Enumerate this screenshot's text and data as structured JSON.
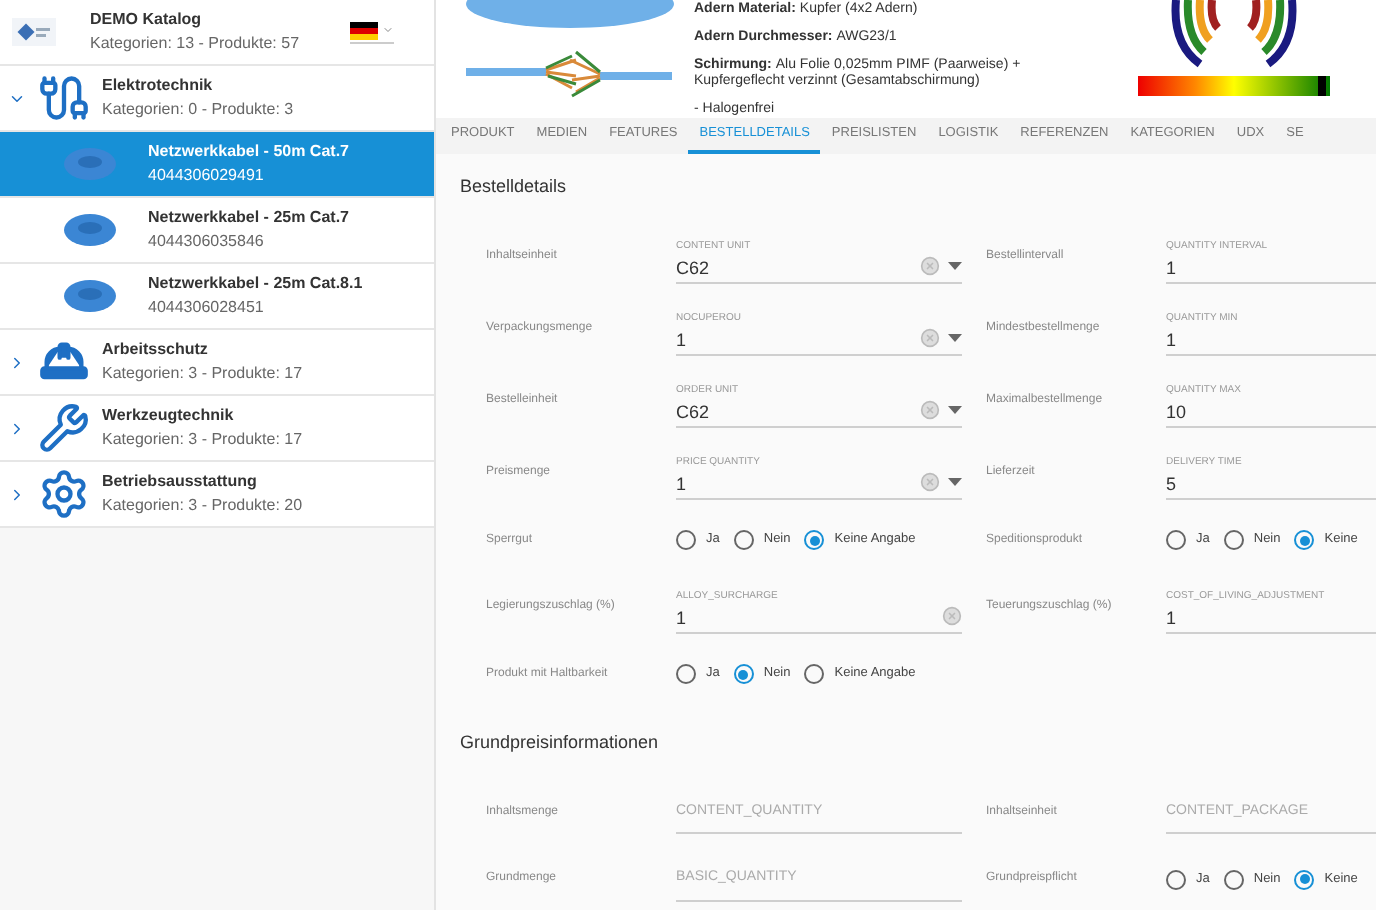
{
  "sidebar": {
    "catalog": {
      "title": "DEMO Katalog",
      "subtitle": "Kategorien: 13 - Produkte: 57"
    },
    "items": [
      {
        "kind": "category",
        "title": "Elektrotechnik",
        "subtitle": "Kategorien: 0 - Produkte: 3",
        "expanded": true,
        "children": [
          {
            "kind": "product",
            "title": "Netzwerkkabel - 50m Cat.7",
            "subtitle": "4044306029491",
            "selected": true
          },
          {
            "kind": "product",
            "title": "Netzwerkkabel - 25m Cat.7",
            "subtitle": "4044306035846",
            "selected": false
          },
          {
            "kind": "product",
            "title": "Netzwerkkabel - 25m Cat.8.1",
            "subtitle": "4044306028451",
            "selected": false
          }
        ]
      },
      {
        "kind": "category",
        "title": "Arbeitsschutz",
        "subtitle": "Kategorien: 3 - Produkte: 17",
        "expanded": false
      },
      {
        "kind": "category",
        "title": "Werkzeugtechnik",
        "subtitle": "Kategorien: 3 - Produkte: 17",
        "expanded": false
      },
      {
        "kind": "category",
        "title": "Betriebsausstattung",
        "subtitle": "Kategorien: 3 - Produkte: 20",
        "expanded": false
      }
    ]
  },
  "product_info": [
    {
      "label": "Adern Material:",
      "value": "Kupfer (4x2 Adern)"
    },
    {
      "label": "Adern Durchmesser:",
      "value": "AWG23/1"
    },
    {
      "label": "Schirmung:",
      "value": "Alu Folie 0,025mm PIMF (Paarweise) + Kupfergeflecht verzinnt (Gesamtabschirmung)"
    },
    {
      "value": "- Halogenfrei"
    }
  ],
  "tabs": [
    {
      "label": "PRODUKT",
      "selected": false
    },
    {
      "label": "MEDIEN",
      "selected": false
    },
    {
      "label": "FEATURES",
      "selected": false
    },
    {
      "label": "BESTELLDETAILS",
      "selected": true
    },
    {
      "label": "PREISLISTEN",
      "selected": false
    },
    {
      "label": "LOGISTIK",
      "selected": false
    },
    {
      "label": "REFERENZEN",
      "selected": false
    },
    {
      "label": "KATEGORIEN",
      "selected": false
    },
    {
      "label": "UDX",
      "selected": false
    },
    {
      "label": "SE",
      "selected": false
    }
  ],
  "sections": [
    {
      "title": "Bestelldetails",
      "rows": [
        [
          {
            "label": "Inhaltseinheit",
            "kind": "select",
            "caption": "CONTENT UNIT",
            "value": "C62"
          },
          {
            "label": "Bestellintervall",
            "kind": "text",
            "caption": "QUANTITY INTERVAL",
            "value": "1"
          }
        ],
        [
          {
            "label": "Verpackungsmenge",
            "kind": "select",
            "caption": "NOCUPEROU",
            "value": "1"
          },
          {
            "label": "Mindestbestellmenge",
            "kind": "text",
            "caption": "QUANTITY MIN",
            "value": "1"
          }
        ],
        [
          {
            "label": "Bestelleinheit",
            "kind": "select",
            "caption": "ORDER UNIT",
            "value": "C62"
          },
          {
            "label": "Maximalbestellmenge",
            "kind": "text",
            "caption": "QUANTITY MAX",
            "value": "10"
          }
        ],
        [
          {
            "label": "Preismenge",
            "kind": "select",
            "caption": "PRICE QUANTITY",
            "value": "1"
          },
          {
            "label": "Lieferzeit",
            "kind": "text",
            "caption": "DELIVERY TIME",
            "value": "5"
          }
        ],
        [
          {
            "label": "Sperrgut",
            "kind": "radio",
            "options": [
              {
                "label": "Ja",
                "selected": false
              },
              {
                "label": "Nein",
                "selected": false
              },
              {
                "label": "Keine Angabe",
                "selected": true
              }
            ]
          },
          {
            "label": "Speditionsprodukt",
            "kind": "radio",
            "options": [
              {
                "label": "Ja",
                "selected": false
              },
              {
                "label": "Nein",
                "selected": false
              },
              {
                "label": "Keine",
                "selected": true
              }
            ]
          }
        ],
        [
          {
            "label": "Legierungszuschlag (%)",
            "kind": "clearable",
            "caption": "ALLOY_SURCHARGE",
            "value": "1"
          },
          {
            "label": "Teuerungszuschlag (%)",
            "kind": "text",
            "caption": "COST_OF_LIVING_ADJUSTMENT",
            "value": "1"
          }
        ],
        [
          {
            "label": "Produkt mit Haltbarkeit",
            "kind": "radio",
            "options": [
              {
                "label": "Ja",
                "selected": false
              },
              {
                "label": "Nein",
                "selected": true
              },
              {
                "label": "Keine Angabe",
                "selected": false
              }
            ]
          }
        ]
      ]
    },
    {
      "title": "Grundpreisinformationen",
      "rows": [
        [
          {
            "label": "Inhaltsmenge",
            "kind": "empty",
            "placeholder": "CONTENT_QUANTITY"
          },
          {
            "label": "Inhaltseinheit",
            "kind": "empty",
            "placeholder": "CONTENT_PACKAGE"
          }
        ],
        [
          {
            "label": "Grundmenge",
            "kind": "empty",
            "placeholder": "BASIC_QUANTITY"
          },
          {
            "label": "Grundpreispflicht",
            "kind": "radio",
            "options": [
              {
                "label": "Ja",
                "selected": false
              },
              {
                "label": "Nein",
                "selected": false
              },
              {
                "label": "Keine",
                "selected": true
              }
            ]
          }
        ]
      ]
    }
  ]
}
